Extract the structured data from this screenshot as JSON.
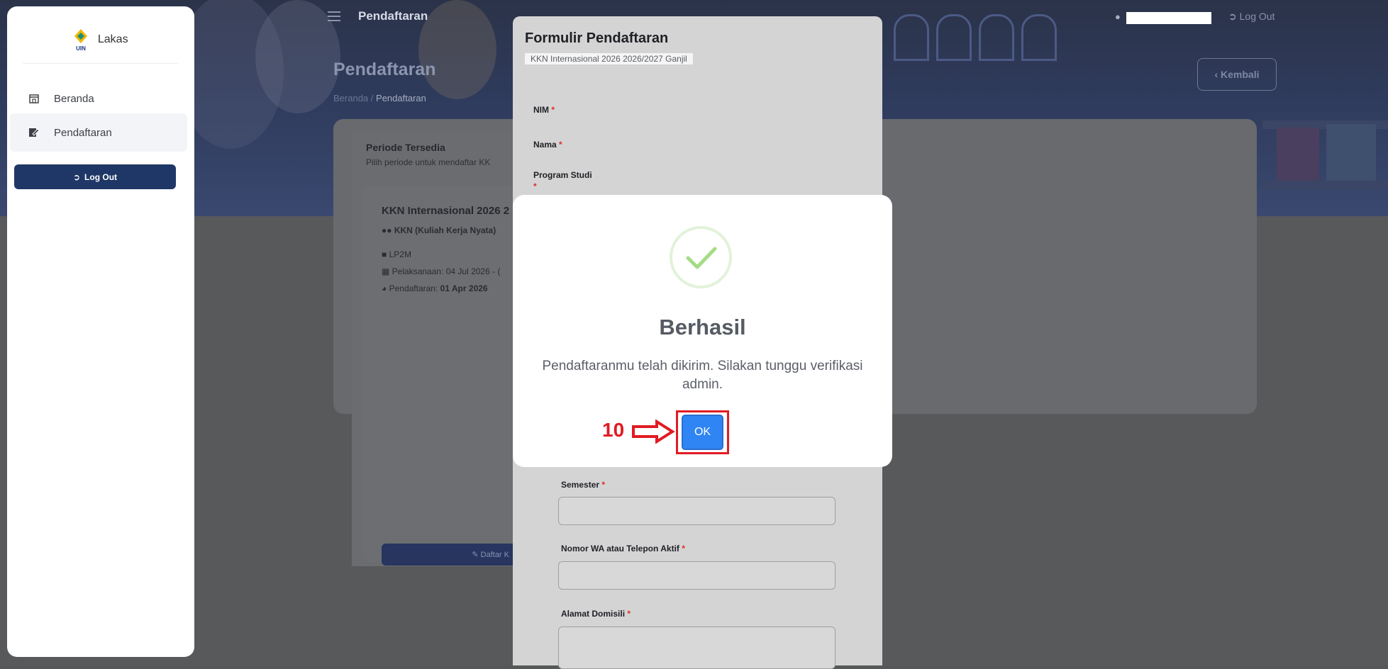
{
  "sidebar": {
    "brand_name": "Lakas",
    "brand_mark": "UIN",
    "items": [
      {
        "label": "Beranda",
        "icon": "home-icon"
      },
      {
        "label": "Pendaftaran",
        "icon": "edit-form-icon"
      }
    ],
    "logout_label": "Log Out"
  },
  "topbar": {
    "title": "Pendaftaran",
    "logout_label": "Log Out"
  },
  "page": {
    "heading": "Pendaftaran",
    "breadcrumb": [
      "Beranda",
      "/",
      "Pendaftaran"
    ],
    "back_label": "‹ Kembali"
  },
  "period": {
    "title": "Periode Tersedia",
    "subtitle": "Pilih periode untuk mendaftar KK",
    "kkn_name": "KKN Internasional 2026 2",
    "kkn_type": "KKN (Kuliah Kerja Nyata)",
    "org": "LP2M",
    "pelaksanaan": "Pelaksanaan: 04 Jul 2026 - (",
    "pendaftaran_prefix": "Pendaftaran: ",
    "pendaftaran_date": "01 Apr 2026",
    "daftar_label": "Daftar K"
  },
  "form": {
    "title": "Formulir Pendaftaran",
    "subtitle": "KKN Internasional 2026 2026/2027 Ganjil",
    "fields": {
      "nim": "NIM",
      "nama": "Nama",
      "prodi": "Program Studi",
      "semester": "Semester",
      "wa": "Nomor WA atau Telepon Aktif",
      "alamat": "Alamat Domisili"
    },
    "required_mark": "*"
  },
  "dialog": {
    "title": "Berhasil",
    "message": "Pendaftaranmu telah dikirim. Silakan tunggu verifikasi admin.",
    "ok_label": "OK"
  },
  "annotation": {
    "step_number": "10",
    "color": "#e11b22"
  },
  "colors": {
    "primary_dark": "#1f3766",
    "ok_blue": "#2f85f3",
    "success_ring": "#e2f2d9",
    "success_check": "#a5dc86"
  }
}
